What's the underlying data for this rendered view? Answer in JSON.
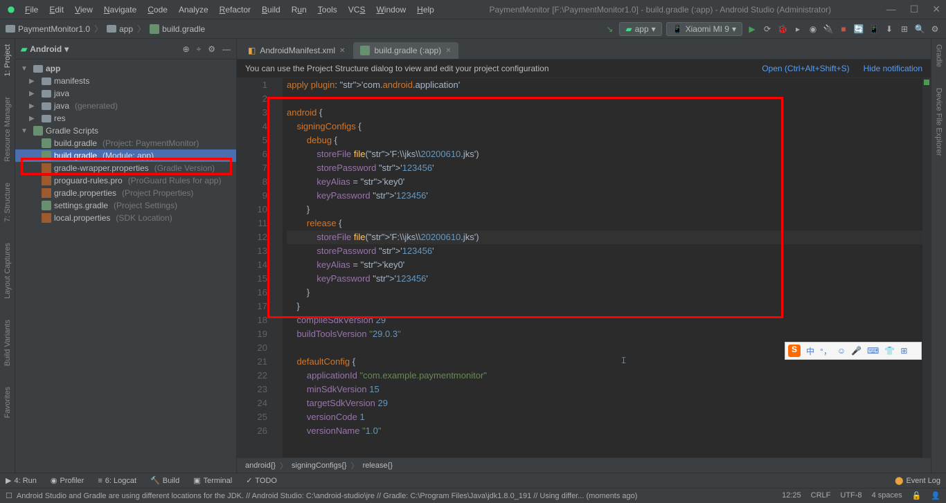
{
  "window": {
    "title": "PaymentMonitor [F:\\PaymentMonitor1.0] - build.gradle (:app) - Android Studio (Administrator)"
  },
  "menu": {
    "file": "File",
    "edit": "Edit",
    "view": "View",
    "navigate": "Navigate",
    "code": "Code",
    "analyze": "Analyze",
    "refactor": "Refactor",
    "build": "Build",
    "run": "Run",
    "tools": "Tools",
    "vcs": "VCS",
    "window": "Window",
    "help": "Help"
  },
  "breadcrumb": {
    "p1": "PaymentMonitor1.0",
    "p2": "app",
    "p3": "build.gradle"
  },
  "toolbar": {
    "run_config": "app",
    "device": "Xiaomi MI 9"
  },
  "project": {
    "dropdown": "Android",
    "root": "app",
    "items": {
      "manifests": "manifests",
      "java": "java",
      "java_gen": "java",
      "java_gen_hint": "(generated)",
      "res": "res",
      "gradle_scripts": "Gradle Scripts",
      "build_gradle_p": "build.gradle",
      "build_gradle_p_hint": "(Project: PaymentMonitor)",
      "build_gradle_a": "build.gradle",
      "build_gradle_a_hint": "(Module: app)",
      "gradle_wrapper": "gradle-wrapper.properties",
      "gradle_wrapper_hint": "(Gradle Version)",
      "proguard": "proguard-rules.pro",
      "proguard_hint": "(ProGuard Rules for app)",
      "gradle_props": "gradle.properties",
      "gradle_props_hint": "(Project Properties)",
      "settings": "settings.gradle",
      "settings_hint": "(Project Settings)",
      "local": "local.properties",
      "local_hint": "(SDK Location)"
    }
  },
  "tabs": {
    "t1": "AndroidManifest.xml",
    "t2": "build.gradle (:app)"
  },
  "notification": {
    "msg": "You can use the Project Structure dialog to view and edit your project configuration",
    "link1": "Open (Ctrl+Alt+Shift+S)",
    "link2": "Hide notification"
  },
  "code": {
    "lines": [
      "apply plugin: 'com.android.application'",
      "",
      "android {",
      "    signingConfigs {",
      "        debug {",
      "            storeFile file('F:\\\\jks\\\\20200610.jks')",
      "            storePassword '123456'",
      "            keyAlias = 'key0'",
      "            keyPassword '123456'",
      "        }",
      "        release {",
      "            storeFile file('F:\\\\jks\\\\20200610.jks')",
      "            storePassword '123456'",
      "            keyAlias = 'key0'",
      "            keyPassword '123456'",
      "        }",
      "    }",
      "    compileSdkVersion 29",
      "    buildToolsVersion \"29.0.3\"",
      "",
      "    defaultConfig {",
      "        applicationId \"com.example.paymentmonitor\"",
      "        minSdkVersion 15",
      "        targetSdkVersion 29",
      "        versionCode 1",
      "        versionName \"1.0\""
    ]
  },
  "editor_crumb": {
    "c1": "android{}",
    "c2": "signingConfigs{}",
    "c3": "release{}"
  },
  "rails": {
    "project": "1: Project",
    "resmgr": "Resource Manager",
    "structure": "7: Structure",
    "captures": "Layout Captures",
    "variants": "Build Variants",
    "favorites": "Favorites",
    "gradle": "Gradle",
    "device": "Device File Explorer"
  },
  "bottom": {
    "run": "4: Run",
    "profiler": "Profiler",
    "logcat": "6: Logcat",
    "build": "Build",
    "terminal": "Terminal",
    "todo": "TODO",
    "event_log": "Event Log"
  },
  "status": {
    "msg": "Android Studio and Gradle are using different locations for the JDK. // Android Studio: C:\\android-studio\\jre // Gradle: C:\\Program Files\\Java\\jdk1.8.0_191 // Using differ... (moments ago)",
    "pos": "12:25",
    "eol": "CRLF",
    "enc": "UTF-8",
    "indent": "4 spaces"
  },
  "ime": {
    "lang": "中"
  }
}
